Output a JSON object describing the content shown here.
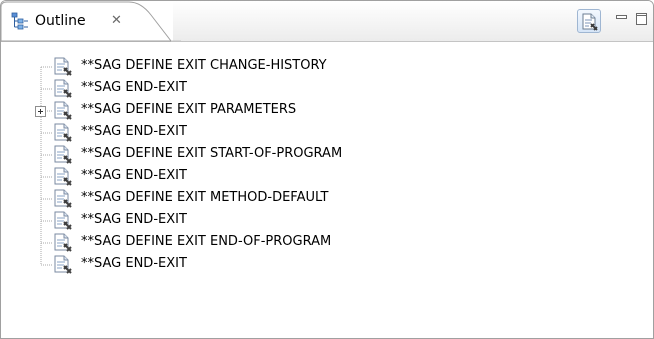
{
  "view": {
    "title": "Outline",
    "close_glyph": "✕",
    "tab_icon": "outline-icon",
    "toolbar_icon": "link-with-editor-icon",
    "minimize_icon": "minimize-icon",
    "maximize_icon": "maximize-icon"
  },
  "tree": {
    "items": [
      {
        "label": "**SAG DEFINE EXIT CHANGE-HISTORY",
        "expandable": false
      },
      {
        "label": "**SAG END-EXIT",
        "expandable": false
      },
      {
        "label": "**SAG DEFINE EXIT PARAMETERS",
        "expandable": true
      },
      {
        "label": "**SAG END-EXIT",
        "expandable": false
      },
      {
        "label": "**SAG DEFINE EXIT START-OF-PROGRAM",
        "expandable": false
      },
      {
        "label": "**SAG END-EXIT",
        "expandable": false
      },
      {
        "label": "**SAG DEFINE EXIT METHOD-DEFAULT",
        "expandable": false
      },
      {
        "label": "**SAG END-EXIT",
        "expandable": false
      },
      {
        "label": "**SAG DEFINE EXIT END-OF-PROGRAM",
        "expandable": false
      },
      {
        "label": "**SAG END-EXIT",
        "expandable": false
      }
    ]
  }
}
